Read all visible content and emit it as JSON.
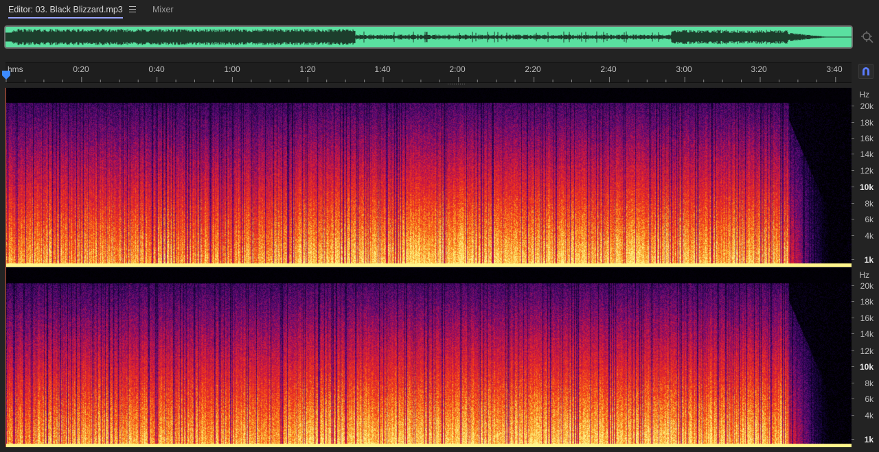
{
  "tabs": {
    "editor_label": "Editor: 03. Black Blizzard.mp3",
    "mixer_label": "Mixer"
  },
  "overview": {
    "waveform_color": "#5ae0a0"
  },
  "ruler": {
    "unit_label": "hms",
    "labels": [
      "0:20",
      "0:40",
      "1:00",
      "1:20",
      "1:40",
      "2:00",
      "2:20",
      "2:40",
      "3:00",
      "3:20",
      "3:40"
    ]
  },
  "hz_scale": {
    "unit": "Hz",
    "labels": [
      "20k",
      "18k",
      "16k",
      "14k",
      "12k",
      "10k",
      "8k",
      "6k",
      "4k",
      "1k"
    ]
  },
  "colors": {
    "accent": "#9aa6ff",
    "playhead": "#3d8bff",
    "snap_icon": "#5a7cff"
  },
  "icons": {
    "tab_menu": "hamburger-menu-icon",
    "zoom": "zoom-crosshair-icon",
    "snap": "magnet-snap-icon",
    "playhead": "playhead-marker-icon"
  }
}
